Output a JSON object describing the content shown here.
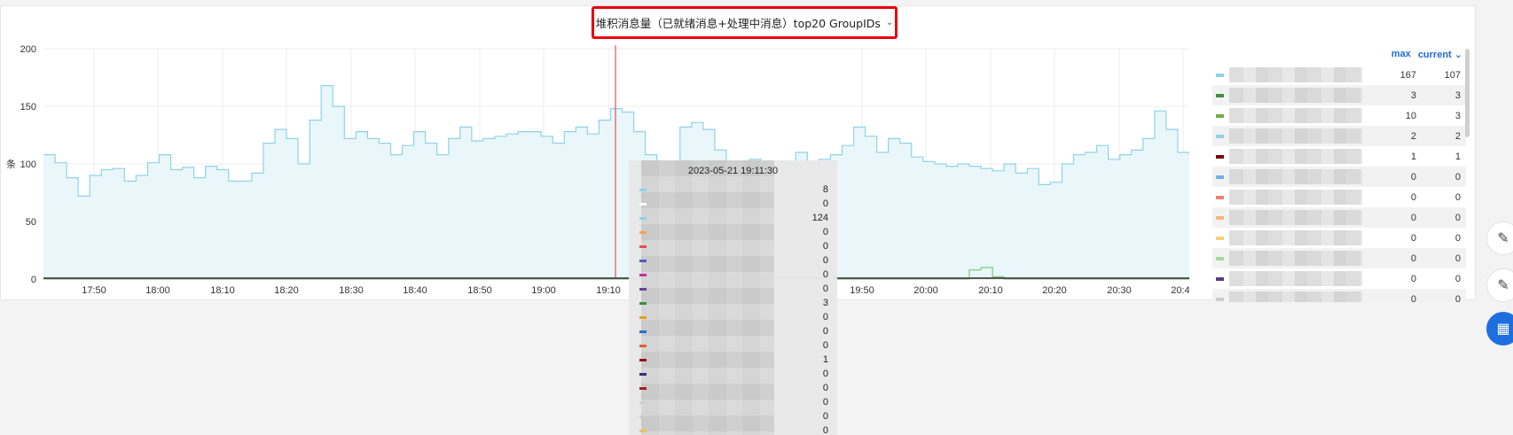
{
  "panel": {
    "title": "堆积消息量（已就绪消息+处理中消息）top20 GroupIDs",
    "dropdown_icon": "chevron-down-icon"
  },
  "chart_data": {
    "type": "area",
    "x_ticks": [
      "17:50",
      "18:00",
      "18:10",
      "18:20",
      "18:30",
      "18:40",
      "18:50",
      "19:00",
      "19:10",
      "19:50",
      "20:00",
      "20:10",
      "20:20",
      "20:30",
      "20:40"
    ],
    "y_ticks": [
      "200",
      "150",
      "100",
      "50",
      "0"
    ],
    "ylabel": "条",
    "ylim": [
      0,
      200
    ],
    "series": [
      {
        "color": "#8fd3e8",
        "values": [
          108,
          101,
          88,
          72,
          90,
          95,
          96,
          85,
          90,
          101,
          108,
          95,
          97,
          88,
          98,
          95,
          85,
          85,
          92,
          118,
          130,
          122,
          100,
          138,
          168,
          150,
          122,
          128,
          122,
          118,
          108,
          116,
          128,
          118,
          108,
          122,
          132,
          120,
          122,
          124,
          126,
          128,
          128,
          124,
          118,
          128,
          132,
          126,
          138,
          148,
          145,
          128,
          108,
          92,
          102,
          132,
          136,
          130,
          112,
          102,
          100,
          104,
          96,
          92,
          98,
          110,
          94,
          104,
          108,
          116,
          132,
          124,
          110,
          122,
          118,
          106,
          102,
          100,
          98,
          100,
          98,
          96,
          94,
          100,
          92,
          96,
          82,
          84,
          100,
          108,
          110,
          116,
          104,
          108,
          112,
          122,
          146,
          130,
          110,
          108
        ]
      },
      {
        "color": "#7fc97f",
        "values": [
          0,
          0,
          0,
          0,
          0,
          0,
          0,
          0,
          0,
          0,
          0,
          0,
          0,
          0,
          0,
          0,
          0,
          0,
          0,
          0,
          0,
          0,
          0,
          0,
          0,
          0,
          0,
          0,
          0,
          0,
          0,
          0,
          0,
          0,
          0,
          0,
          0,
          0,
          0,
          0,
          0,
          0,
          0,
          0,
          0,
          0,
          0,
          0,
          0,
          0,
          0,
          0,
          0,
          0,
          0,
          0,
          0,
          0,
          0,
          0,
          0,
          0,
          0,
          0,
          0,
          0,
          0,
          0,
          0,
          0,
          0,
          0,
          0,
          0,
          0,
          0,
          0,
          0,
          0,
          0,
          8,
          10,
          2,
          0,
          0,
          0,
          0,
          0,
          0,
          0,
          0,
          0,
          0,
          0,
          0,
          0,
          0,
          0,
          0,
          0
        ]
      }
    ],
    "crosshair_time": "2023-05-21 19:11:30"
  },
  "legend": {
    "col_max": "max",
    "col_current": "current",
    "rows": [
      {
        "color": "#8fd3e8",
        "max": "167",
        "current": "107"
      },
      {
        "color": "#3f8f3f",
        "max": "3",
        "current": "3"
      },
      {
        "color": "#6ab04c",
        "max": "10",
        "current": "3"
      },
      {
        "color": "#8fd3e8",
        "max": "2",
        "current": "2"
      },
      {
        "color": "#7a0000",
        "max": "1",
        "current": "1"
      },
      {
        "color": "#6fb1e0",
        "max": "0",
        "current": "0"
      },
      {
        "color": "#f08070",
        "max": "0",
        "current": "0"
      },
      {
        "color": "#f5b87a",
        "max": "0",
        "current": "0"
      },
      {
        "color": "#f7d27a",
        "max": "0",
        "current": "0"
      },
      {
        "color": "#a8d8a0",
        "max": "0",
        "current": "0"
      },
      {
        "color": "#5c3a8a",
        "max": "0",
        "current": "0"
      },
      {
        "color": "#cccccc",
        "max": "0",
        "current": "0"
      }
    ]
  },
  "tooltip": {
    "time": "2023-05-21 19:11:30",
    "rows": [
      {
        "color": "#8fd3e8",
        "value": "8"
      },
      {
        "color": "#ffffff",
        "value": "0"
      },
      {
        "color": "#8fd3e8",
        "value": "124"
      },
      {
        "color": "#f5a35a",
        "value": "0"
      },
      {
        "color": "#e05050",
        "value": "0"
      },
      {
        "color": "#5060c0",
        "value": "0"
      },
      {
        "color": "#c030a0",
        "value": "0"
      },
      {
        "color": "#7040a0",
        "value": "0"
      },
      {
        "color": "#3f8f3f",
        "value": "3"
      },
      {
        "color": "#e0a020",
        "value": "0"
      },
      {
        "color": "#3070d0",
        "value": "0"
      },
      {
        "color": "#e06030",
        "value": "0"
      },
      {
        "color": "#9a1010",
        "value": "1"
      },
      {
        "color": "#303080",
        "value": "0"
      },
      {
        "color": "#a02020",
        "value": "0"
      },
      {
        "color": "#d0d0d0",
        "value": "0"
      },
      {
        "color": "#cccccc",
        "value": "0"
      },
      {
        "color": "#f0c060",
        "value": "0"
      }
    ]
  },
  "side_actions": [
    {
      "icon": "edit-icon"
    },
    {
      "icon": "feedback-icon"
    },
    {
      "icon": "apps-icon"
    }
  ]
}
